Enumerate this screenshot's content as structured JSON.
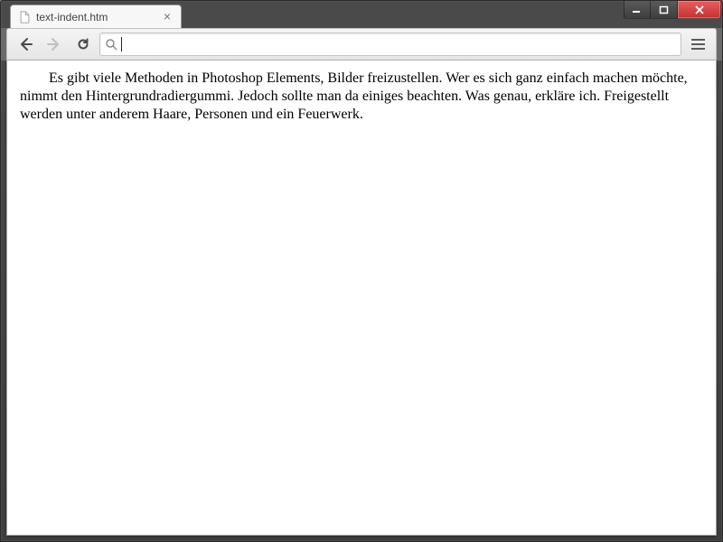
{
  "window": {
    "minimize_label": "Minimize",
    "maximize_label": "Maximize",
    "close_label": "Close"
  },
  "tab": {
    "title": "text-indent.htm",
    "close_label": "Close tab"
  },
  "toolbar": {
    "back_label": "Back",
    "forward_label": "Forward",
    "reload_label": "Reload",
    "menu_label": "Menu"
  },
  "omnibox": {
    "value": "",
    "placeholder": ""
  },
  "page": {
    "paragraph": "Es gibt viele Methoden in Photoshop Elements, Bilder freizustellen. Wer es sich ganz einfach machen möchte, nimmt den Hintergrundradiergummi. Jedoch sollte man da einiges beachten. Was genau, erkläre ich. Freigestellt werden unter anderem Haare, Personen und ein Feuerwerk."
  }
}
